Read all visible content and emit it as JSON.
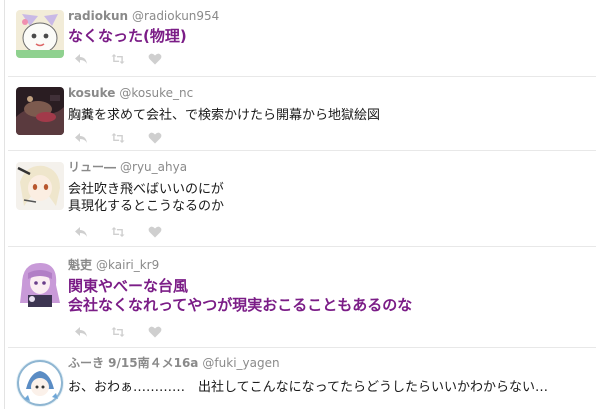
{
  "tweets": [
    {
      "name": "radiokun",
      "handle": "@radiokun954",
      "text_lines": [
        "なくなった(物理)"
      ],
      "style": "big",
      "avatar_icon": "cartoon-cat-avatar"
    },
    {
      "name": "kosuke",
      "handle": "@kosuke_nc",
      "text_lines": [
        "胸糞を求めて会社、で検索かけたら開幕から地獄絵図"
      ],
      "style": "normal",
      "avatar_icon": "dark-photo-avatar"
    },
    {
      "name": "リュー―",
      "handle": "@ryu_ahya",
      "text_lines": [
        "会社吹き飛べばいいのにが",
        "具現化するとこうなるのか"
      ],
      "style": "normal",
      "avatar_icon": "anime-girl-avatar"
    },
    {
      "name": "魁吏",
      "handle": "@kairi_kr9",
      "text_lines": [
        "関東やべーな台風",
        "会社なくなれってやつが現実おこることもあるのな"
      ],
      "style": "big",
      "avatar_icon": "purple-hair-avatar"
    },
    {
      "name": "ふーき 9/15南４メ16a",
      "handle": "@fuki_yagen",
      "text_lines": [
        "お、おわぁ…………　出社してこんなになってたらどうしたらいいかわからない…"
      ],
      "style": "normal",
      "avatar_icon": "blue-character-avatar"
    }
  ],
  "actions": {
    "reply_icon": "reply-icon",
    "retweet_icon": "retweet-icon",
    "like_icon": "heart-icon"
  },
  "colors": {
    "name_gray": "#8a8a8a",
    "highlight_purple": "#7b1d87",
    "body_text": "#1a1a1a",
    "icon_gray": "#cfcfcf",
    "divider": "#e8e8e8"
  }
}
